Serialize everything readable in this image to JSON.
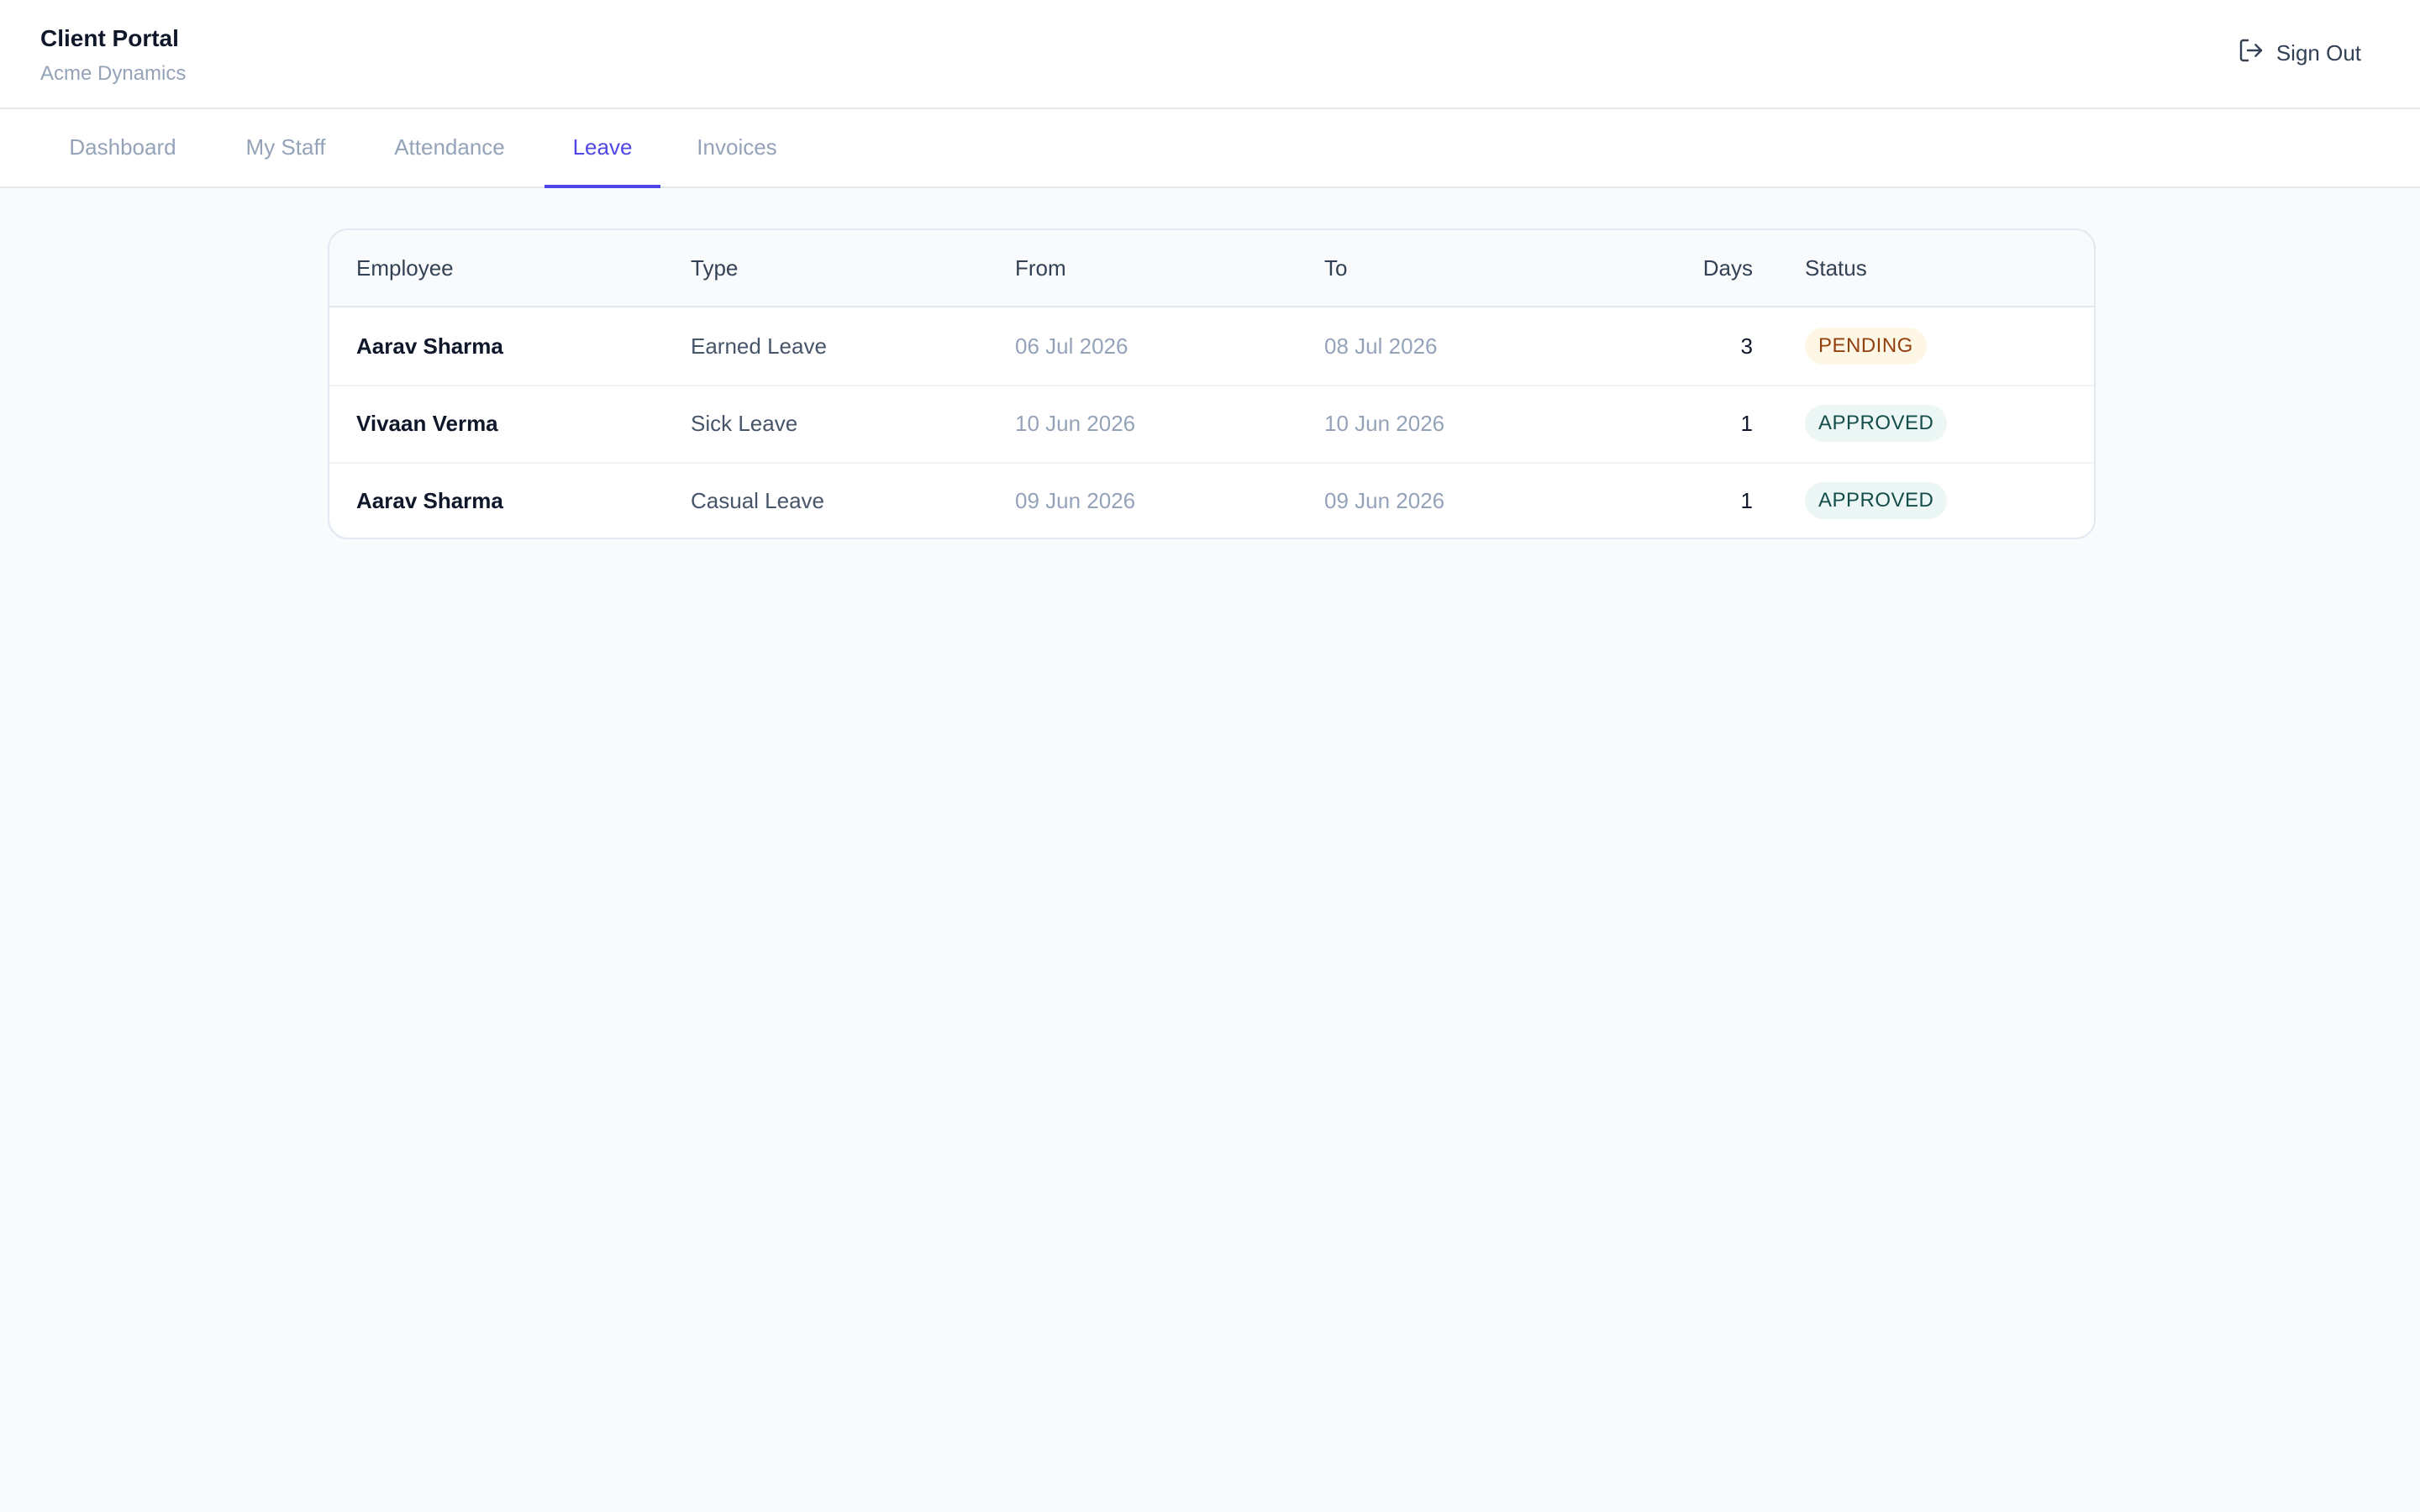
{
  "header": {
    "title": "Client Portal",
    "subtitle": "Acme Dynamics",
    "signout_label": "Sign Out"
  },
  "tabs": [
    {
      "label": "Dashboard",
      "active": false
    },
    {
      "label": "My Staff",
      "active": false
    },
    {
      "label": "Attendance",
      "active": false
    },
    {
      "label": "Leave",
      "active": true
    },
    {
      "label": "Invoices",
      "active": false
    }
  ],
  "table": {
    "columns": [
      "Employee",
      "Type",
      "From",
      "To",
      "Days",
      "Status"
    ],
    "rows": [
      {
        "employee": "Aarav Sharma",
        "type": "Earned Leave",
        "from": "06 Jul 2026",
        "to": "08 Jul 2026",
        "days": "3",
        "status": "PENDING"
      },
      {
        "employee": "Vivaan Verma",
        "type": "Sick Leave",
        "from": "10 Jun 2026",
        "to": "10 Jun 2026",
        "days": "1",
        "status": "APPROVED"
      },
      {
        "employee": "Aarav Sharma",
        "type": "Casual Leave",
        "from": "09 Jun 2026",
        "to": "09 Jun 2026",
        "days": "1",
        "status": "APPROVED"
      }
    ]
  },
  "colors": {
    "accent": "#4f46e5",
    "pending_bg": "#fff7e6",
    "pending_text": "#92400e",
    "approved_bg": "#ecf6f4",
    "approved_text": "#134e4a"
  },
  "icons": {
    "signout": "sign-out-icon"
  }
}
